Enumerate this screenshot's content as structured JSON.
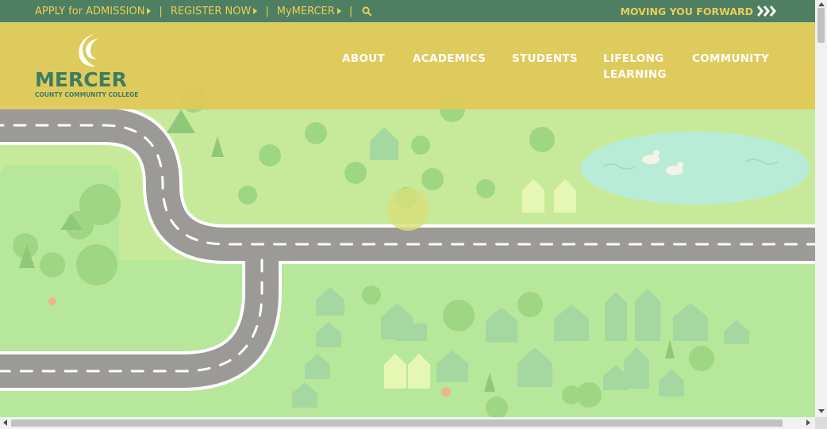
{
  "topbar": {
    "links": [
      {
        "label": "APPLY for ADMISSION"
      },
      {
        "label": "REGISTER NOW"
      },
      {
        "label": "MyMERCER"
      }
    ],
    "separator": "|",
    "search_icon": "search-icon",
    "tagline": "MOVING YOU FORWARD",
    "tagline_icon": "triple-chevron-right-icon"
  },
  "logo": {
    "name": "MERCER",
    "subtitle": "COUNTY COMMUNITY COLLEGE"
  },
  "nav": {
    "items": [
      {
        "label": "ABOUT"
      },
      {
        "label": "ACADEMICS"
      },
      {
        "label": "STUDENTS"
      },
      {
        "label": "LIFELONG",
        "label2": "LEARNING"
      },
      {
        "label": "COMMUNITY"
      }
    ]
  },
  "hero": {
    "description_icon": "town-road-map-illustration"
  },
  "colors": {
    "topbar_bg": "#4e7f63",
    "topbar_text": "#e9cf55",
    "nav_band": "#e0c858",
    "logo_green": "#3d7d62",
    "grass": "#c7ea9a",
    "road": "#9a9a96",
    "pond": "#b9ecd6"
  }
}
